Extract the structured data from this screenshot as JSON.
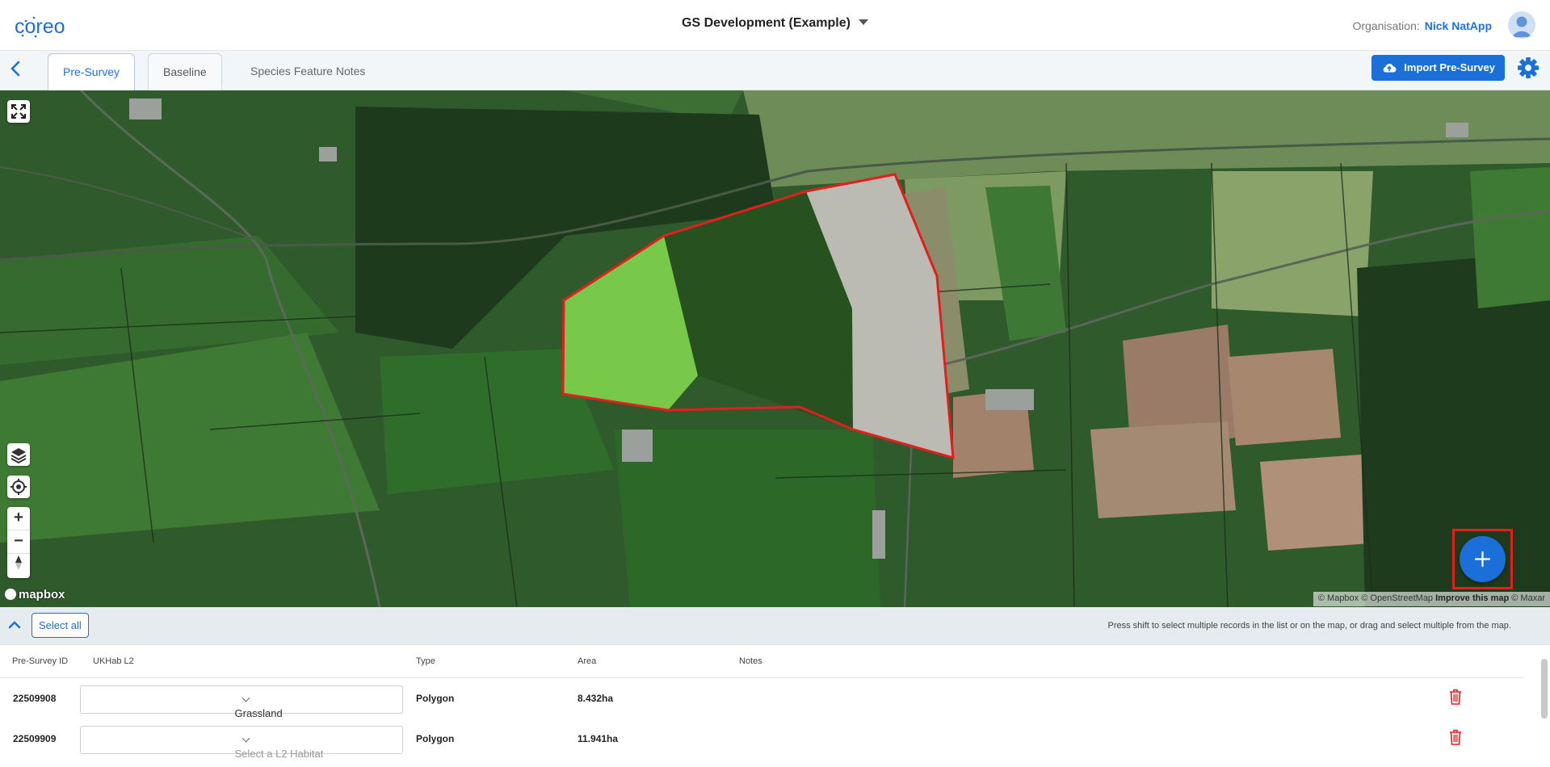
{
  "app": {
    "logo_text": "coreo",
    "project_title": "GS Development (Example)",
    "organisation_label": "Organisation:",
    "organisation_name": "Nick NatApp"
  },
  "tabs": [
    {
      "label": "Pre-Survey",
      "active": true
    },
    {
      "label": "Baseline",
      "active": false
    },
    {
      "label": "Species Feature Notes",
      "active": false
    }
  ],
  "actions": {
    "import_label": "Import Pre-Survey"
  },
  "map": {
    "mapbox_label": "mapbox",
    "attribution_mapbox": "© Mapbox",
    "attribution_osm": "© OpenStreetMap",
    "attribution_improve": "Improve this map",
    "attribution_maxar": "© Maxar",
    "polygon_colors": {
      "outline": "#e41e1e",
      "grassland": "#7dc94a",
      "unassigned": "#b9b9b9"
    }
  },
  "list_toolbar": {
    "select_all_label": "Select all",
    "hint": "Press shift to select multiple records in the list or on the map, or drag and select multiple from the map."
  },
  "table": {
    "columns": [
      "Pre-Survey ID",
      "UKHab L2",
      "Type",
      "Area",
      "Notes"
    ],
    "rows": [
      {
        "id": "22509908",
        "habitat": "Grassland",
        "type": "Polygon",
        "area": "8.432ha",
        "notes": ""
      },
      {
        "id": "22509909",
        "habitat": "Select a L2 Habitat",
        "type": "Polygon",
        "area": "11.941ha",
        "notes": ""
      }
    ]
  },
  "colors": {
    "accent": "#1a6fd8",
    "danger": "#e0201c"
  }
}
